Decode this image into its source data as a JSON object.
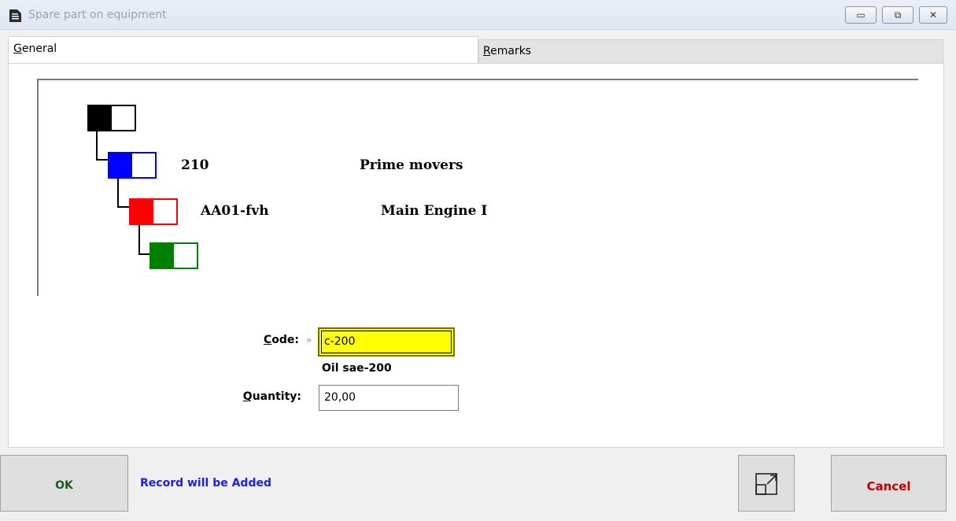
{
  "window": {
    "title": "Spare part on equipment"
  },
  "window_controls": {
    "min_glyph": "▭",
    "max_glyph": "⧉",
    "close_glyph": "✕"
  },
  "tabs": [
    {
      "label": "General",
      "accel": "G",
      "rest": "eneral"
    },
    {
      "label": "Remarks",
      "accel": "R",
      "rest": "emarks"
    }
  ],
  "tree": {
    "levels": [
      {
        "color": "#000000",
        "code": "",
        "name": ""
      },
      {
        "color": "#0000ff",
        "code": "210",
        "name": "Prime movers"
      },
      {
        "color": "#ff0000",
        "code": "AA01-fvh",
        "name": "Main Engine I"
      },
      {
        "color": "#008000",
        "code": "",
        "name": ""
      }
    ]
  },
  "form": {
    "code_label": {
      "accel": "C",
      "rest": "ode:"
    },
    "code_marker": "»",
    "code_value": "c-200",
    "code_description": "Oil sae-200",
    "quantity_label": {
      "accel": "Q",
      "rest": "uantity:"
    },
    "quantity_value": "20,00"
  },
  "footer": {
    "ok_label": "OK",
    "status_text": "Record will be Added",
    "cancel_label": "Cancel"
  },
  "colors": {
    "code_field_bg": "#ffff00",
    "status": "#1a1aff",
    "cancel": "#c00000",
    "ok": "#1d5a1d"
  }
}
